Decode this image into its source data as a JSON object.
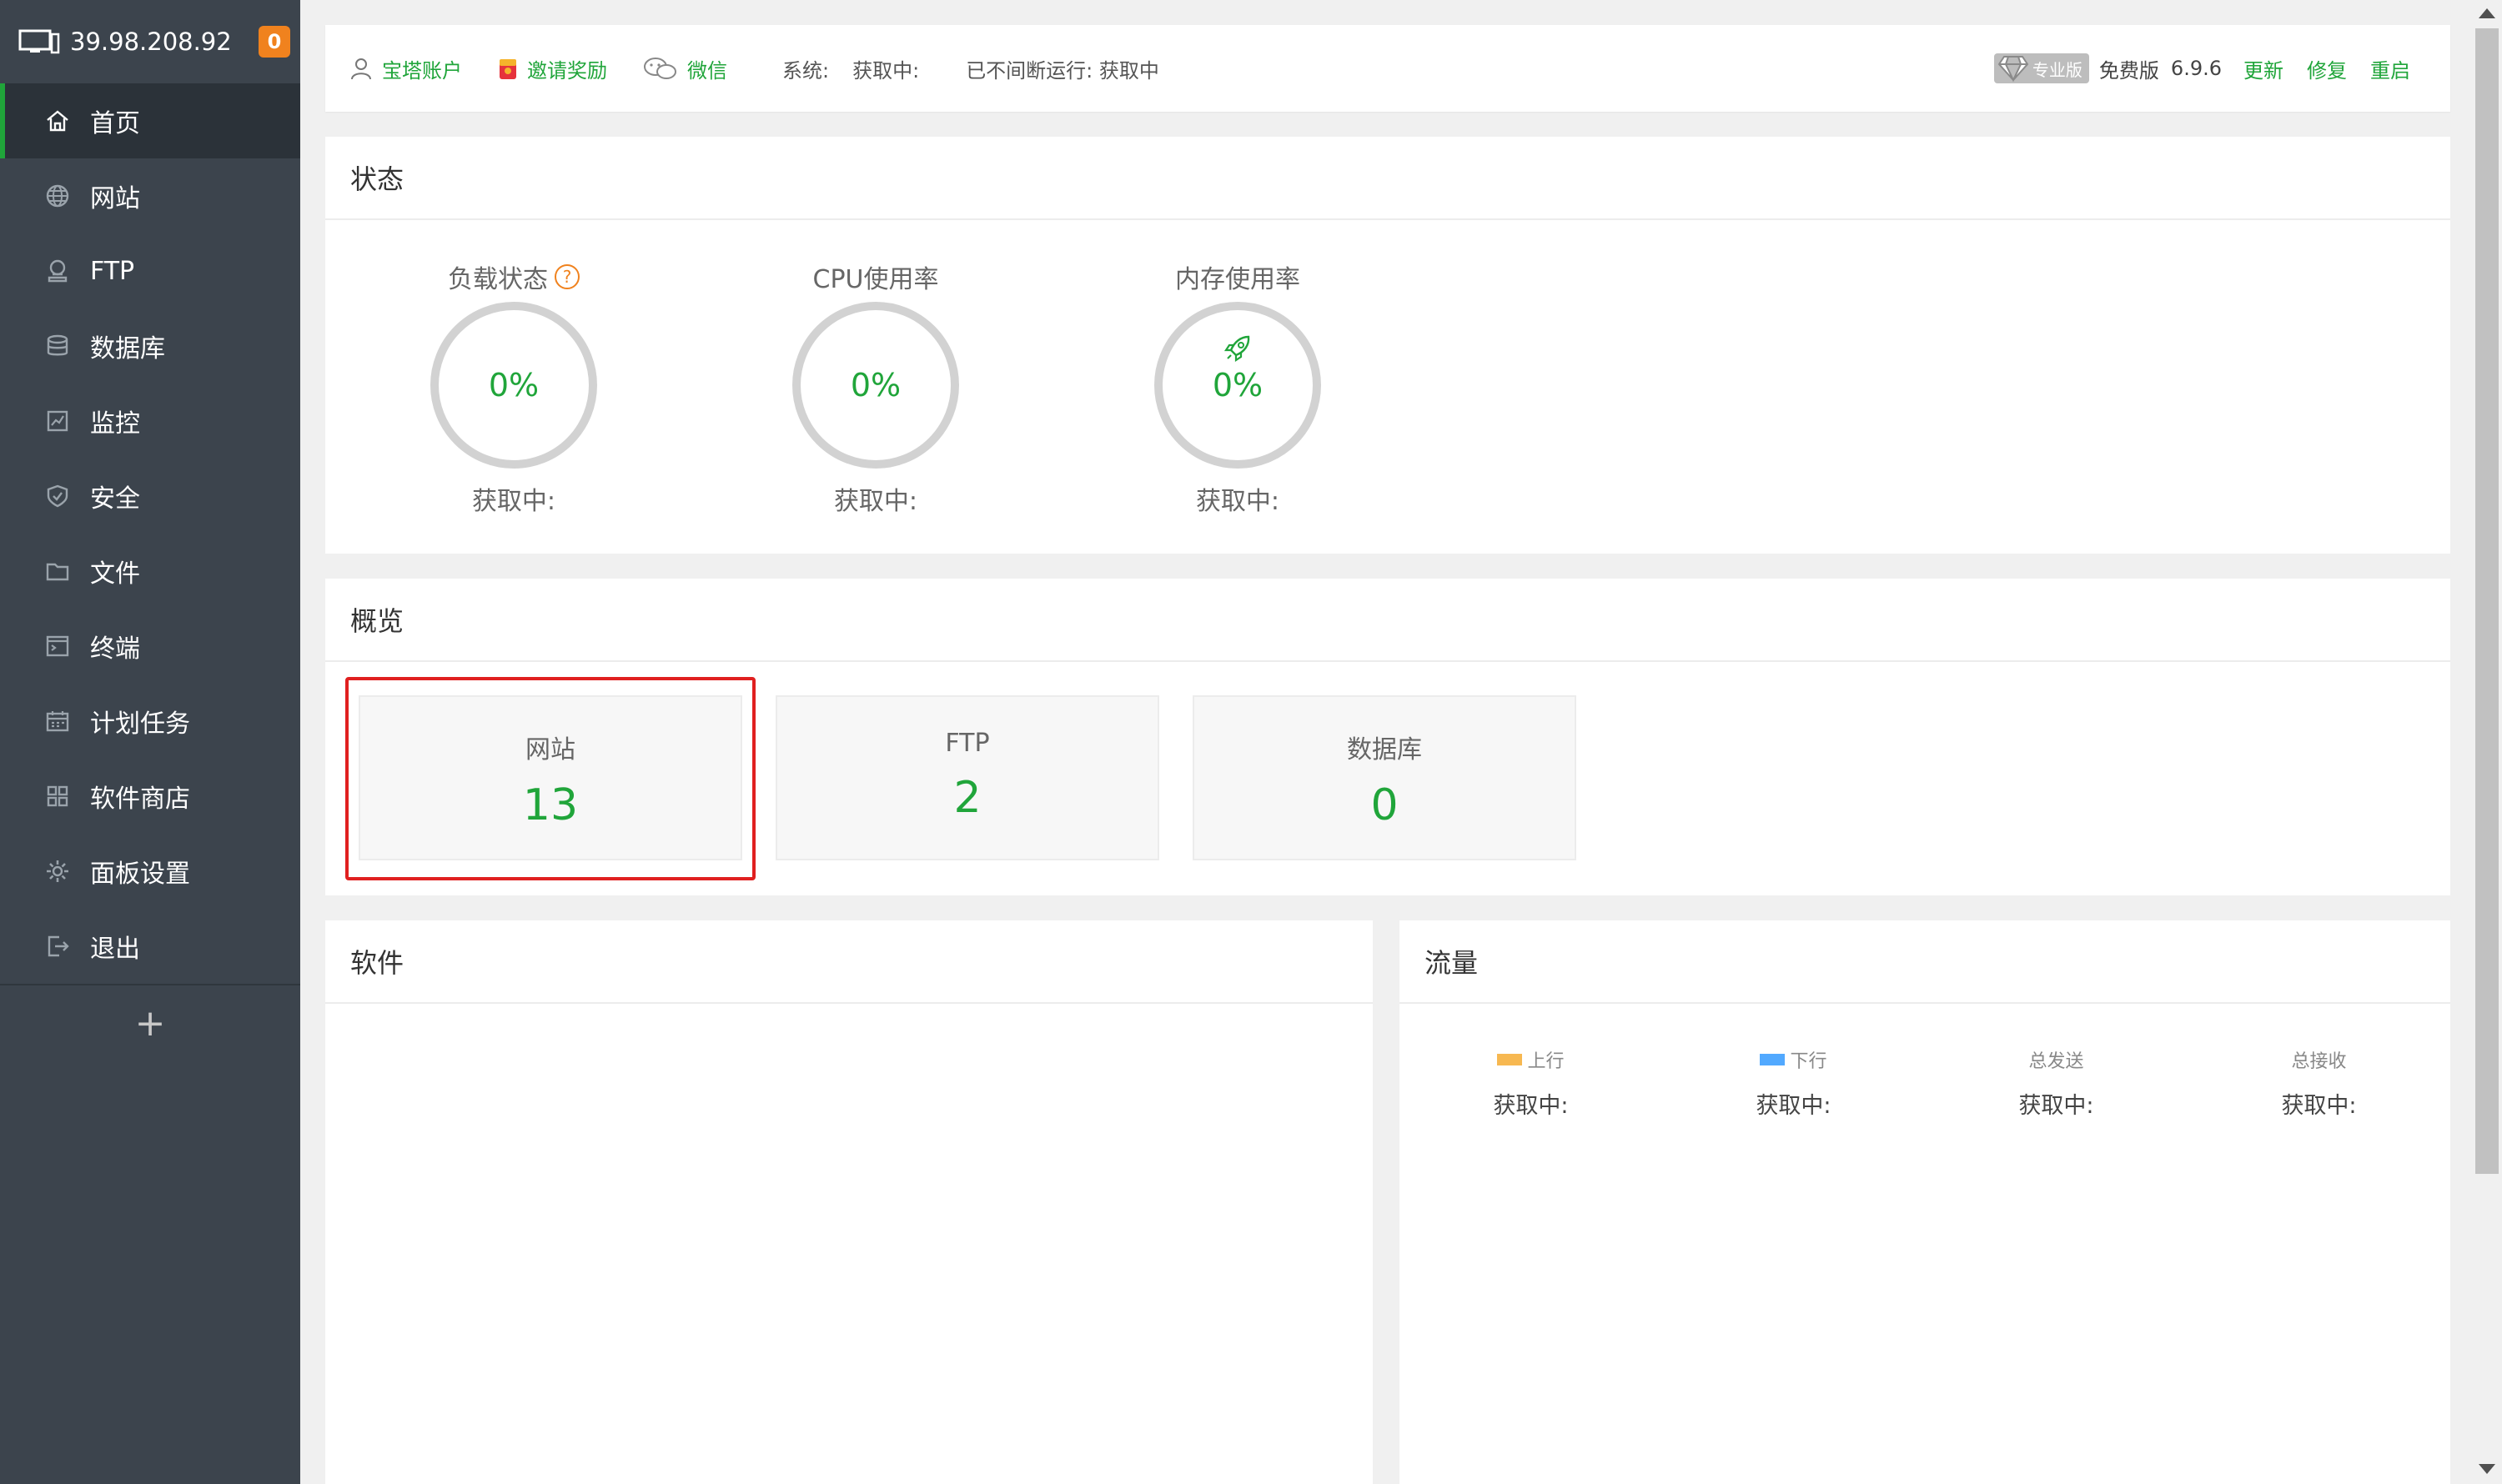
{
  "sidebar": {
    "host": "39.98.208.92",
    "badge": "0",
    "items": [
      {
        "label": "首页",
        "icon": "home-icon"
      },
      {
        "label": "网站",
        "icon": "globe-icon"
      },
      {
        "label": "FTP",
        "icon": "ftp-icon"
      },
      {
        "label": "数据库",
        "icon": "database-icon"
      },
      {
        "label": "监控",
        "icon": "monitor-icon"
      },
      {
        "label": "安全",
        "icon": "shield-icon"
      },
      {
        "label": "文件",
        "icon": "folder-icon"
      },
      {
        "label": "终端",
        "icon": "terminal-icon"
      },
      {
        "label": "计划任务",
        "icon": "calendar-icon"
      },
      {
        "label": "软件商店",
        "icon": "apps-icon"
      },
      {
        "label": "面板设置",
        "icon": "gear-icon"
      },
      {
        "label": "退出",
        "icon": "logout-icon"
      }
    ],
    "add": "+"
  },
  "topbar": {
    "account": "宝塔账户",
    "invite": "邀请奖励",
    "wechat": "微信",
    "system_label": "系统:",
    "system_value": "获取中:",
    "uptime": "已不间断运行: 获取中",
    "pro": "专业版",
    "edition": "免费版",
    "version": "6.9.6",
    "update": "更新",
    "repair": "修复",
    "restart": "重启"
  },
  "status": {
    "title": "状态",
    "gauges": [
      {
        "label": "负载状态",
        "value": "0%",
        "sub": "获取中:"
      },
      {
        "label": "CPU使用率",
        "value": "0%",
        "sub": "获取中:"
      },
      {
        "label": "内存使用率",
        "value": "0%",
        "sub": "获取中:"
      }
    ],
    "help": "?"
  },
  "overview": {
    "title": "概览",
    "cards": [
      {
        "name": "网站",
        "value": "13"
      },
      {
        "name": "FTP",
        "value": "2"
      },
      {
        "name": "数据库",
        "value": "0"
      }
    ]
  },
  "software": {
    "title": "软件"
  },
  "traffic": {
    "title": "流量",
    "columns": [
      {
        "label": "上行",
        "value": "获取中:",
        "color": "#f7b851"
      },
      {
        "label": "下行",
        "value": "获取中:",
        "color": "#52a9ff"
      },
      {
        "label": "总发送",
        "value": "获取中:"
      },
      {
        "label": "总接收",
        "value": "获取中:"
      }
    ]
  },
  "colors": {
    "accent": "#20a53a",
    "sidebar": "#3c444d",
    "badge": "#f0821e",
    "highlight": "#e02020"
  }
}
